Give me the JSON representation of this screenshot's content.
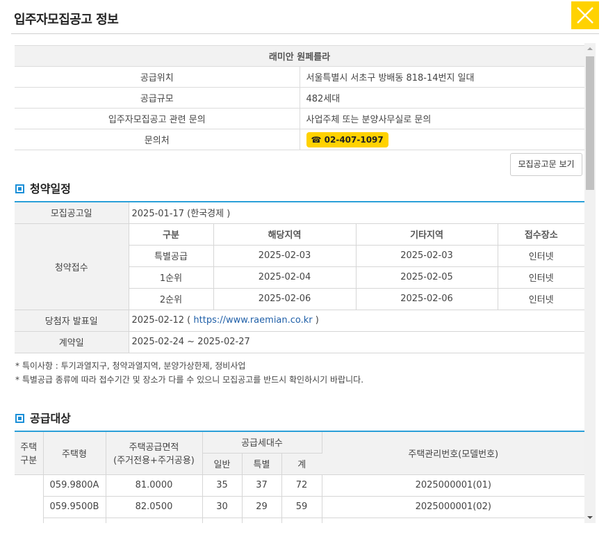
{
  "header": {
    "title": "입주자모집공고 정보"
  },
  "icons": {
    "close": "close-x-icon",
    "phone": "telephone-icon"
  },
  "colors": {
    "accent": "#ffd200",
    "blue": "#2a9fd8"
  },
  "complex": {
    "name": "래미안 원페를라",
    "rows": [
      {
        "label": "공급위치",
        "value": "서울특별시 서초구 방배동 818-14번지 일대"
      },
      {
        "label": "공급규모",
        "value": "482세대"
      },
      {
        "label": "입주자모집공고 관련 문의",
        "value": "사업주체 또는 분양사무실로 문의"
      }
    ],
    "contact_label": "문의처",
    "phone_glyph": "☎",
    "phone": "02-407-1097"
  },
  "notice_button": "모집공고문 보기",
  "schedule": {
    "heading": "청약일정",
    "announce_label": "모집공고일",
    "announce_value": "2025-01-17 (한국경제 )",
    "reception_label": "청약접수",
    "columns": [
      "구분",
      "해당지역",
      "기타지역",
      "접수장소"
    ],
    "rows": [
      [
        "특별공급",
        "2025-02-03",
        "2025-02-03",
        "인터넷"
      ],
      [
        "1순위",
        "2025-02-04",
        "2025-02-05",
        "인터넷"
      ],
      [
        "2순위",
        "2025-02-06",
        "2025-02-06",
        "인터넷"
      ]
    ],
    "winner_label": "당첨자 발표일",
    "winner_date": "2025-02-12 (",
    "winner_link": "https://www.raemian.co.kr",
    "winner_close": ")",
    "contract_label": "계약일",
    "contract_value": "2025-02-24 ~ 2025-02-27"
  },
  "notes": [
    "* 특이사항 : 투기과열지구, 청약과열지역, 분양가상한제, 정비사업",
    "* 특별공급 종류에 따라 접수기간 및 장소가 다를 수 있으니 모집공고를 반드시 확인하시기 바랍니다."
  ],
  "supply": {
    "heading": "공급대상",
    "h_type_a": "주택",
    "h_type_b": "구분",
    "h_model": "주택형",
    "h_area_a": "주택공급면적",
    "h_area_b": "(주거전용+주거공용)",
    "h_units": "공급세대수",
    "h_general": "일반",
    "h_special": "특별",
    "h_total": "계",
    "h_code": "주택관리번호(모델번호)",
    "rows": [
      [
        "059.9800A",
        "81.0000",
        "35",
        "37",
        "72",
        "2025000001(01)"
      ],
      [
        "059.9500B",
        "82.0500",
        "30",
        "29",
        "59",
        "2025000001(02)"
      ]
    ]
  }
}
